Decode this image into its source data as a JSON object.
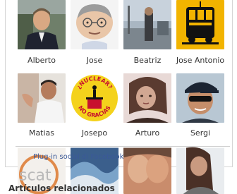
{
  "friends": [
    {
      "name": "Alberto"
    },
    {
      "name": "Jose"
    },
    {
      "name": "Beatriz"
    },
    {
      "name": "Jose Antonio"
    },
    {
      "name": "Matias"
    },
    {
      "name": "Josepo"
    },
    {
      "name": "Arturo"
    },
    {
      "name": "Sergi"
    }
  ],
  "partial_row_count": 4,
  "badge_texts": {
    "nuclear_top": "¿NUCLEAR?",
    "nuclear_bottom": "NO GRACIAS",
    "logo_partial": "scat"
  },
  "plugin_label": "Plug-in social di Facebook",
  "section_title": "Artículos relacionados"
}
